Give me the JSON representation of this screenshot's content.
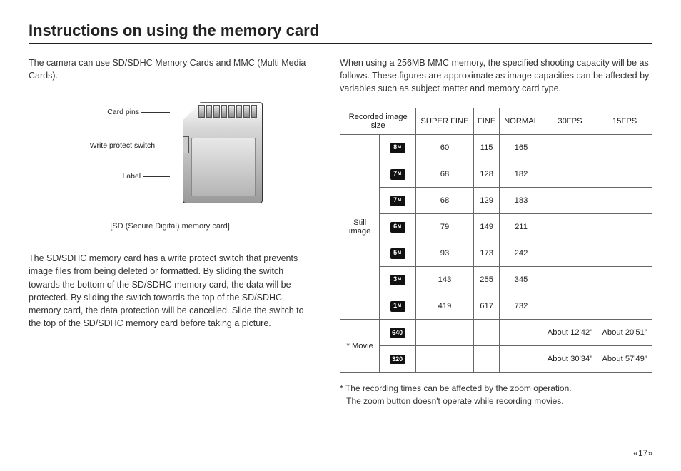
{
  "title": "Instructions on using the memory card",
  "left": {
    "p1": "The camera can use SD/SDHC Memory Cards and MMC (Multi Media Cards).",
    "diagram": {
      "label_pins": "Card pins",
      "label_switch": "Write protect switch",
      "label_label": "Label",
      "caption": "[SD (Secure Digital) memory card]"
    },
    "p2": "The SD/SDHC memory card has a write protect switch that prevents image files from being deleted or formatted. By sliding the switch towards the bottom of the SD/SDHC memory card, the data will be protected. By sliding the switch towards the top of the SD/SDHC memory card, the data protection will be cancelled. Slide the switch to the top of the SD/SDHC memory card before taking a picture."
  },
  "right": {
    "intro": "When using a 256MB MMC memory, the specified shooting capacity will be as follows. These figures are approximate as image capacities can be affected by variables such as subject matter and memory card type.",
    "table": {
      "headers": [
        "Recorded image size",
        "SUPER FINE",
        "FINE",
        "NORMAL",
        "30FPS",
        "15FPS"
      ],
      "group_still": "Still image",
      "group_movie": "* Movie",
      "still_rows": [
        {
          "icon": "8",
          "sf": "60",
          "fine": "115",
          "normal": "165"
        },
        {
          "icon": "7",
          "sf": "68",
          "fine": "128",
          "normal": "182"
        },
        {
          "icon": "7",
          "sf": "68",
          "fine": "129",
          "normal": "183"
        },
        {
          "icon": "6",
          "sf": "79",
          "fine": "149",
          "normal": "211"
        },
        {
          "icon": "5",
          "sf": "93",
          "fine": "173",
          "normal": "242"
        },
        {
          "icon": "3",
          "sf": "143",
          "fine": "255",
          "normal": "345"
        },
        {
          "icon": "1",
          "sf": "419",
          "fine": "617",
          "normal": "732"
        }
      ],
      "movie_rows": [
        {
          "icon": "640",
          "f30": "About 12'42\"",
          "f15": "About 20'51\""
        },
        {
          "icon": "320",
          "f30": "About 30'34\"",
          "f15": "About 57'49\""
        }
      ]
    },
    "footnote1": "* The recording times can be affected by the zoom operation.",
    "footnote2": "The zoom button doesn't operate while recording movies."
  },
  "page_number": "«17»"
}
